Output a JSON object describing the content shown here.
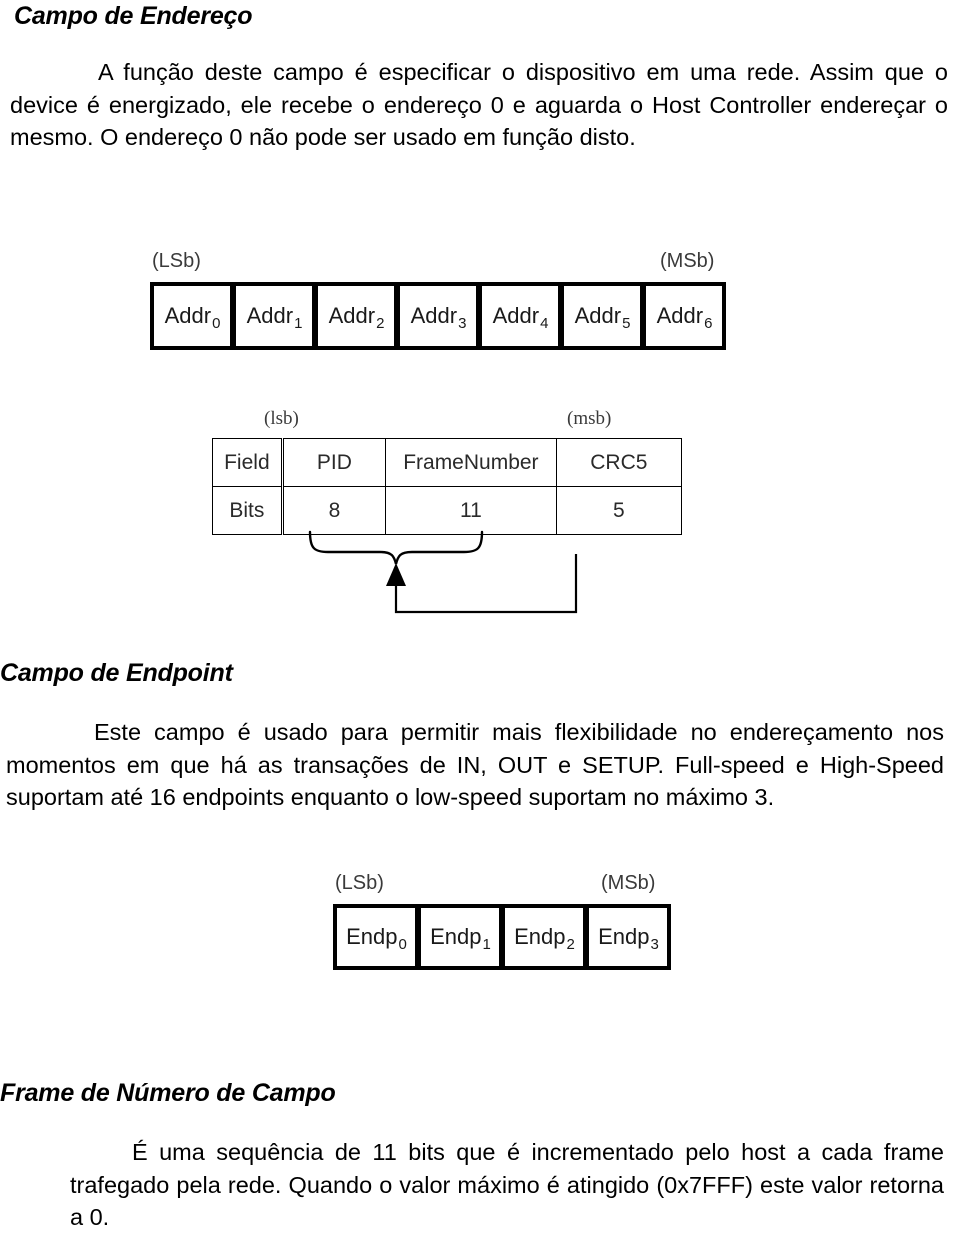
{
  "document": {
    "sections": [
      {
        "heading": "Campo de Endereço",
        "body": "A função deste campo é especificar o dispositivo em uma rede. Assim que o device é energizado, ele recebe o endereço 0 e aguarda o Host Controller endereçar o mesmo. O endereço 0 não pode ser usado em função disto."
      },
      {
        "heading": "Campo de Endpoint",
        "body": "Este campo é usado para permitir mais flexibilidade no endereçamento nos momentos em que há as transações de IN, OUT e SETUP. Full-speed e High-Speed suportam até 16 endpoints enquanto o low-speed suportam no máximo 3."
      },
      {
        "heading": "Frame de Número de Campo",
        "body": "É uma sequência de 11 bits que é incrementado pelo host a cada frame trafegado pela rede. Quando o valor máximo é atingido (0x7FFF) este valor retorna a 0."
      }
    ]
  },
  "figures": {
    "address_field": {
      "lsb_label": "(LSb)",
      "msb_label": "(MSb)",
      "cells": [
        {
          "name": "Addr",
          "index": "0"
        },
        {
          "name": "Addr",
          "index": "1"
        },
        {
          "name": "Addr",
          "index": "2"
        },
        {
          "name": "Addr",
          "index": "3"
        },
        {
          "name": "Addr",
          "index": "4"
        },
        {
          "name": "Addr",
          "index": "5"
        },
        {
          "name": "Addr",
          "index": "6"
        }
      ]
    },
    "token_packet": {
      "lsb_label": "(lsb)",
      "msb_label": "(msb)",
      "rows": [
        {
          "label": "Field",
          "pid": "PID",
          "framenumber": "FrameNumber",
          "crc": "CRC5"
        },
        {
          "label": "Bits",
          "pid": "8",
          "framenumber": "11",
          "crc": "5"
        }
      ]
    },
    "endpoint_field": {
      "lsb_label": "(LSb)",
      "msb_label": "(MSb)",
      "cells": [
        {
          "name": "Endp",
          "index": "0"
        },
        {
          "name": "Endp",
          "index": "1"
        },
        {
          "name": "Endp",
          "index": "2"
        },
        {
          "name": "Endp",
          "index": "3"
        }
      ]
    }
  },
  "colors": {
    "text": "#000000",
    "figure_stroke": "#000000",
    "figure_label": "#3a3a3a",
    "background": "#ffffff"
  }
}
